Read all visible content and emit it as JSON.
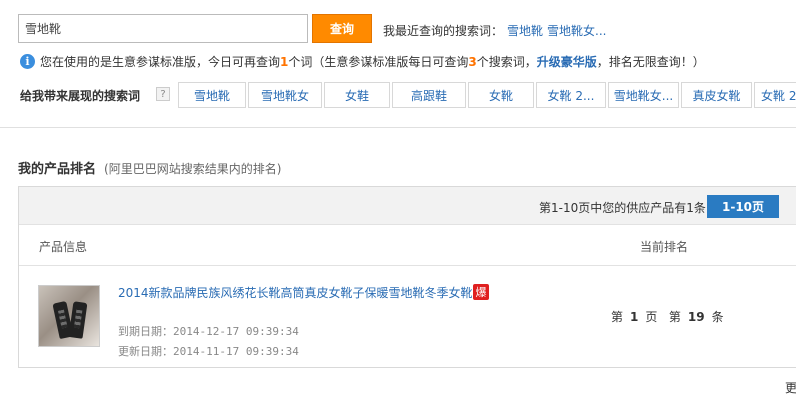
{
  "search": {
    "value": "雪地靴",
    "button_label": "查询"
  },
  "recent": {
    "label": "我最近查询的搜索词：",
    "items": [
      "雪地靴",
      "雪地靴女..."
    ]
  },
  "notice": {
    "part1": "您在使用的是生意参谋标准版，今日可再查询",
    "count1": "1",
    "part2": "个词（生意参谋标准版每日可查询",
    "count2": "3",
    "part3": "个搜索词，",
    "upgrade_link": "升级豪华版",
    "part4": "，排名无限查询！）"
  },
  "keywords": {
    "label": "给我带来展现的搜索词",
    "help": "?",
    "items": [
      "雪地靴",
      "雪地靴女",
      "女鞋",
      "高跟鞋",
      "女靴",
      "女靴 2...",
      "雪地靴女...",
      "真皮女靴",
      "女靴 2"
    ]
  },
  "ranking": {
    "title": "我的产品排名",
    "subtitle": "(阿里巴巴网站搜索结果内的排名)",
    "supply_text": "第1-10页中您的供应产品有1条",
    "page_button": "1-10页",
    "col_info": "产品信息",
    "col_rank": "当前排名",
    "product": {
      "title": "2014新款品牌民族风绣花长靴高筒真皮女靴子保暖雪地靴冬季女靴",
      "hot_badge": "爆",
      "expire_label": "到期日期：",
      "expire_date": "2014-12-17 09:39:34",
      "update_label": "更新日期：",
      "update_date": "2014-11-17 09:39:34",
      "rank_prefix": "第",
      "rank_page": "1",
      "rank_page_unit": "页",
      "rank_prefix2": "第",
      "rank_item": "19",
      "rank_item_unit": "条"
    }
  },
  "footer": {
    "more": "更"
  },
  "colors": {
    "accent_orange": "#ff8a00",
    "link_blue": "#2a6cb4",
    "button_blue": "#2a7bc2",
    "hot_red": "#e02020"
  }
}
